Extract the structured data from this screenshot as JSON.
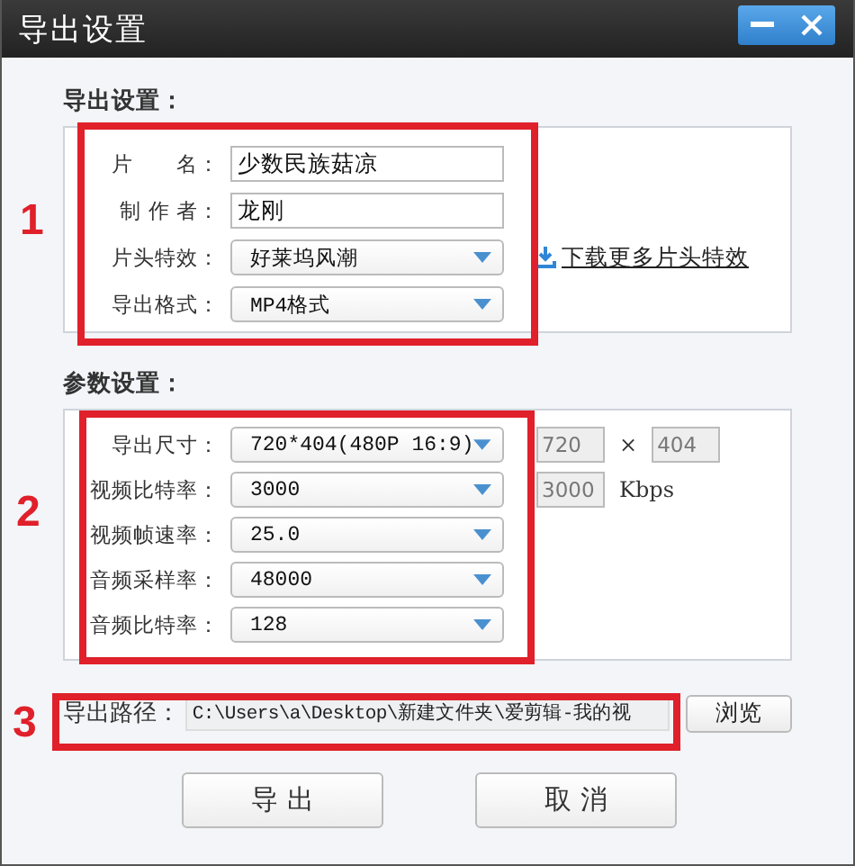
{
  "window": {
    "title": "导出设置"
  },
  "export_settings": {
    "heading": "导出设置：",
    "fields": [
      {
        "label": "片　　名：",
        "kind": "text",
        "value": "少数民族菇凉"
      },
      {
        "label": "制 作 者：",
        "kind": "text",
        "value": "龙刚"
      },
      {
        "label": "片头特效：",
        "kind": "dropdown",
        "value": "好莱坞风潮",
        "link": "下载更多片头特效"
      },
      {
        "label": "导出格式：",
        "kind": "dropdown",
        "value": "MP4格式"
      }
    ]
  },
  "parameters": {
    "heading": "参数设置：",
    "fields": [
      {
        "label": "导出尺寸：",
        "kind": "dropdown",
        "value": "720*404(480P 16:9)",
        "extras": [
          {
            "kind": "input",
            "value": "720",
            "disabled": true
          },
          {
            "kind": "text",
            "text": "×"
          },
          {
            "kind": "input",
            "value": "404",
            "disabled": true
          }
        ]
      },
      {
        "label": "视频比特率：",
        "kind": "dropdown",
        "value": "3000",
        "extras": [
          {
            "kind": "input",
            "value": "3000",
            "disabled": true
          },
          {
            "kind": "text",
            "text": "Kbps"
          }
        ]
      },
      {
        "label": "视频帧速率：",
        "kind": "dropdown",
        "value": "25.0"
      },
      {
        "label": "音频采样率：",
        "kind": "dropdown",
        "value": "48000"
      },
      {
        "label": "音频比特率：",
        "kind": "dropdown",
        "value": "128"
      }
    ]
  },
  "export_path": {
    "label": "导出路径：",
    "value": "C:\\Users\\a\\Desktop\\新建文件夹\\爱剪辑-我的视",
    "browse": "浏览"
  },
  "buttons": [
    "导 出",
    "取 消"
  ],
  "annotations": [
    {
      "number": "1"
    },
    {
      "number": "2"
    },
    {
      "number": "3"
    }
  ]
}
